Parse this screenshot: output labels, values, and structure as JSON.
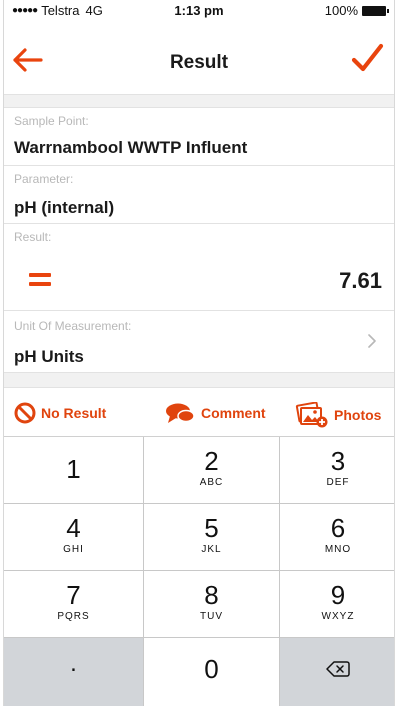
{
  "status_bar": {
    "signal": "●●●●●",
    "carrier": "Telstra",
    "network": "4G",
    "time": "1:13 pm",
    "battery": "100%"
  },
  "nav": {
    "title": "Result",
    "back_icon": "arrow-left-icon",
    "confirm_icon": "checkmark-icon"
  },
  "fields": {
    "sample_point": {
      "label": "Sample Point:",
      "value": "Warrnambool WWTP Influent"
    },
    "parameter": {
      "label": "Parameter:",
      "value": "pH (internal)"
    },
    "result": {
      "label": "Result:",
      "operator": "=",
      "value": "7.61"
    },
    "unit": {
      "label": "Unit Of Measurement:",
      "value": "pH Units"
    }
  },
  "actions": {
    "no_result": "No Result",
    "comment": "Comment",
    "photos": "Photos"
  },
  "keypad": {
    "keys": [
      {
        "digit": "1",
        "letters": ""
      },
      {
        "digit": "2",
        "letters": "ABC"
      },
      {
        "digit": "3",
        "letters": "DEF"
      },
      {
        "digit": "4",
        "letters": "GHI"
      },
      {
        "digit": "5",
        "letters": "JKL"
      },
      {
        "digit": "6",
        "letters": "MNO"
      },
      {
        "digit": "7",
        "letters": "PQRS"
      },
      {
        "digit": "8",
        "letters": "TUV"
      },
      {
        "digit": "9",
        "letters": "WXYZ"
      }
    ],
    "dot": ".",
    "zero": "0"
  },
  "colors": {
    "accent": "#e9440e",
    "keypad_gray": "#d2d5d9",
    "divider": "#e2e2e2",
    "label_gray": "#b8b8b8"
  }
}
